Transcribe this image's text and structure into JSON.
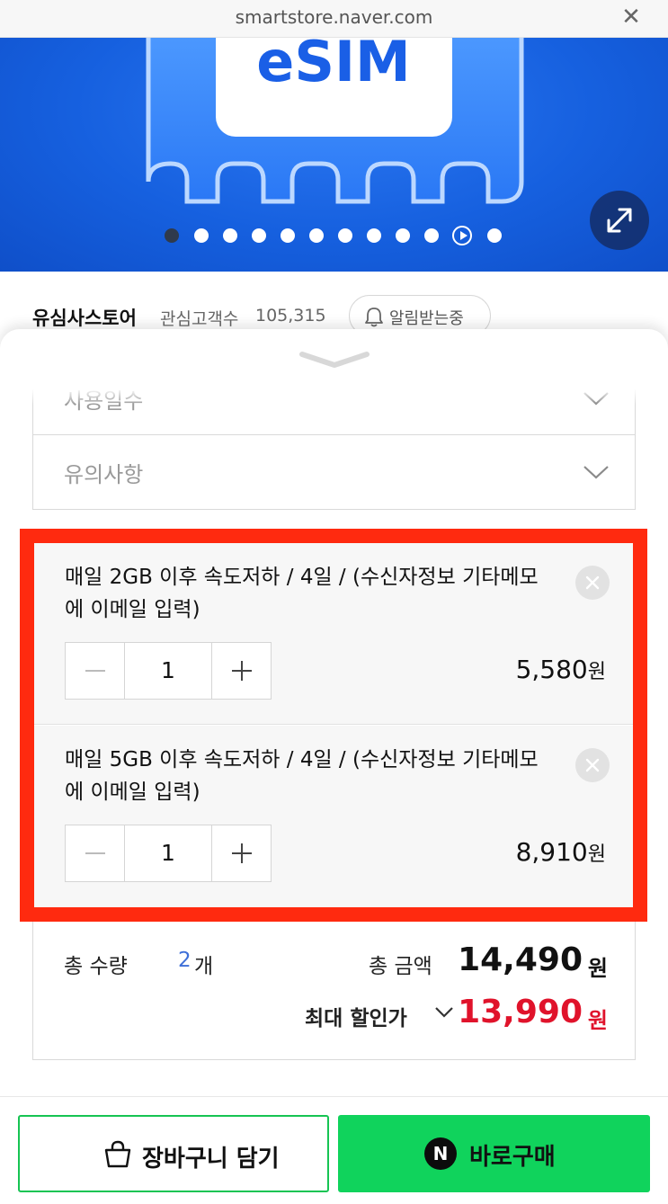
{
  "browser": {
    "url": "smartstore.naver.com",
    "close_icon": "close-icon"
  },
  "hero": {
    "logo_text": "eSIM",
    "slide_count": 11,
    "active_slide": 1
  },
  "store": {
    "name": "유심사스토어",
    "fans_label": "관심고객수",
    "fans_count": "105,315",
    "alarm_label": "알림받는중"
  },
  "selects": [
    {
      "label": "사용일수"
    },
    {
      "label": "유의사항"
    }
  ],
  "options": [
    {
      "name": "매일 2GB 이후 속도저하 / 4일 / (수신자정보 기타메모에 이메일 입력)",
      "quantity": "1",
      "price": "5,580",
      "currency": "원"
    },
    {
      "name": "매일 5GB 이후 속도저하 / 4일 / (수신자정보 기타메모에 이메일 입력)",
      "quantity": "1",
      "price": "8,910",
      "currency": "원"
    }
  ],
  "totals": {
    "quantity_label": "총 수량",
    "quantity_value": "2",
    "quantity_unit": "개",
    "amount_label": "총 금액",
    "amount_value": "14,490",
    "currency": "원",
    "max_discount_label": "최대 할인가",
    "max_discount_value": "13,990"
  },
  "actions": {
    "cart_label": "장바구니 담기",
    "buy_label": "바로구매",
    "naver_badge": "N"
  },
  "colors": {
    "highlight": "#ff2a0f",
    "green": "#10d35c",
    "discount_red": "#e0132b",
    "quantity_blue": "#3e6fd8",
    "hero_blue": "#1660df"
  }
}
